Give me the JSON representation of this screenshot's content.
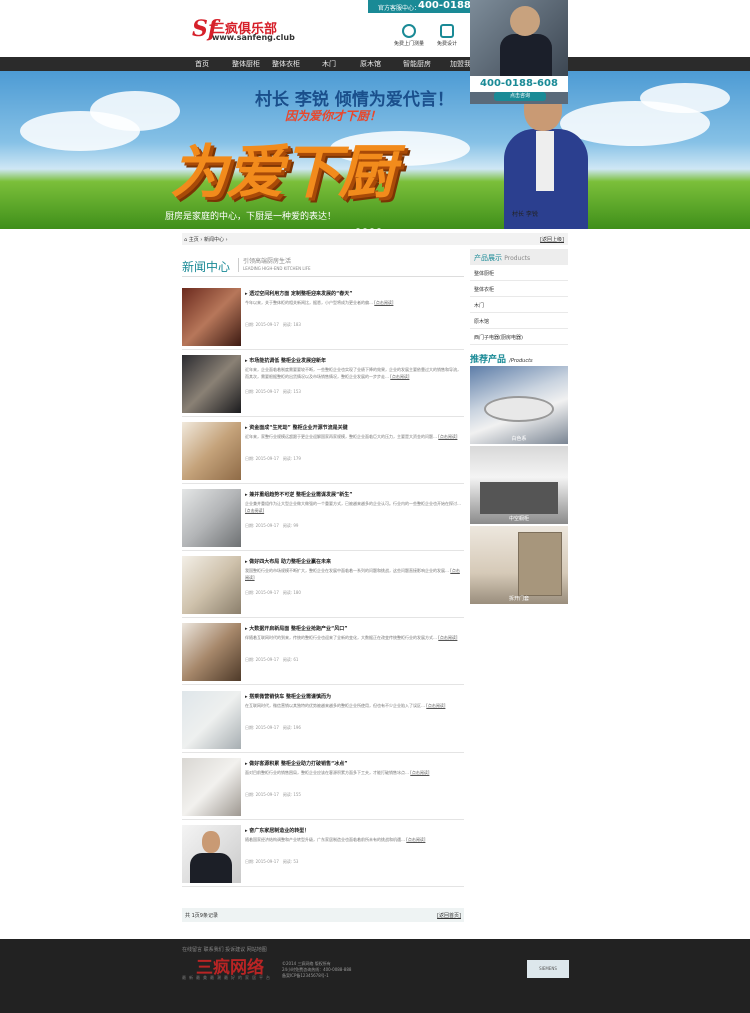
{
  "header": {
    "logo_mark": "Sf",
    "logo_text": "三疯俱乐部",
    "logo_url": "www.sanfeng.club",
    "hotline_label": "官方客服中心：",
    "hotline_number": "400-0188-6",
    "icons": [
      {
        "name": "measure-icon",
        "label": "免费上门测量"
      },
      {
        "name": "design-icon",
        "label": "免费设计"
      }
    ]
  },
  "nav": {
    "items": [
      "首页",
      "整体厨柜",
      "整体衣柜",
      "木门",
      "原木馆",
      "智能厨房",
      "加盟我"
    ]
  },
  "float_ad": {
    "number": "400-0188-608",
    "button": "点击咨询"
  },
  "banner": {
    "title1": "村长 李锐 倾情为爱代言！",
    "title2": "因为爱你才下厨！",
    "big": "为爱下厨",
    "slogan": "厨房是家庭的中心，下厨是一种爱的表达！",
    "caption": "村长 李锐"
  },
  "breadcrumb": {
    "home": "主页",
    "current": "新闻中心",
    "back": "[返回上级]"
  },
  "section": {
    "title": "新闻中心",
    "sub1": "引领高端厨房生活",
    "sub2": "LEADING HIGH-END KITCHEN LIFE"
  },
  "news": [
    {
      "title": "透过空间利用方面 定制整柜迎来发展的“春天”",
      "desc": "今年以来，关于整体柜的相关新闻比，据悉，小户型将成为更业者的偏…",
      "date": "日期: 2015-09-17",
      "views": "阅读: 183",
      "more": "[点击阅读]"
    },
    {
      "title": "市场能抗调低 整柜企业发展迎新年",
      "desc": "近年来，企业面临着制度需要要较不断，一些整柜企业也实现了业绩下降的效果，企业的发展主要依靠过大的销售和导流，而其次，需要根据整柜的出货情况以及市场销售情况，整柜企业发展的一步步走…",
      "date": "日期: 2015-09-17",
      "views": "阅读: 153",
      "more": "[点击阅读]"
    },
    {
      "title": "资金面成“生死劫” 整柜企业开源节流是关键",
      "desc": "近年来，家整行业规模远超跟于更企业迎解国家再家规模，整柜企业面临巨大的压力，主要是大资金的问题…",
      "date": "日期: 2015-09-17",
      "views": "阅读: 179",
      "more": "[点击阅读]"
    },
    {
      "title": "兼并重组趋势不可逆 整柜企业需谋发展“新生”",
      "desc": "企业兼并重组作为让大型企业做大做强的一个重要方式，已被越来越多的企业认可。行业内的一些整柜企业也开始在探讨…",
      "date": "日期: 2015-09-17",
      "views": "阅读: 99",
      "more": "[点击阅读]"
    },
    {
      "title": "做好四大布局 助力整柜企业赢在未来",
      "desc": "我国整柜行业的市场规模不断扩大，整柜企业在发展中面临着一系列的问题和挑战，这些问题直接影响企业的发展…",
      "date": "日期: 2015-09-17",
      "views": "阅读: 180",
      "more": "[点击阅读]"
    },
    {
      "title": "大数据开启新局面 整柜企业抢跑产业“风口”",
      "desc": "伴随着互联网时代的到来，传统的整柜行业也迎来了全新的变化，大数据正在改变传统整柜行业的发展方式…",
      "date": "日期: 2015-09-17",
      "views": "阅读: 61",
      "more": "[点击阅读]"
    },
    {
      "title": "搭乘微营销快车 整柜企业需谨慎而为",
      "desc": "在互联网时代，微信营销以其独特的优势被越来越多的整柜企业所使用，但也有不少企业陷入了误区…",
      "date": "日期: 2015-09-17",
      "views": "阅读: 196",
      "more": "[点击阅读]"
    },
    {
      "title": "做好客源积累 整柜企业助力打破销售“冰点”",
      "desc": "面对目前整柜行业的销售困局，整柜企业应该在客源积累方面多下工夫，才能打破销售冰点…",
      "date": "日期: 2015-09-17",
      "views": "阅读: 155",
      "more": "[点击阅读]"
    },
    {
      "title": "奋广东家居制造业的转型！",
      "desc": "随着国家经济结构调整和产业转型升级，广东家居制造业也面临着前所未有的挑战和机遇…",
      "date": "日期: 2015-09-17",
      "views": "阅读: 53",
      "more": "[点击阅读]"
    }
  ],
  "pager": {
    "left": "共 1页9条记录",
    "right": "[返回首页]"
  },
  "sidebar": {
    "products_title": "产品展示",
    "products_en": "Products",
    "items": [
      "整体厨柜",
      "整体衣柜",
      "木门",
      "原木馆",
      "西门子电器(厨房电器)"
    ],
    "recommend_title": "推荐产品",
    "recommend_en": "/Products",
    "recommends": [
      "白色系",
      "中空橱柜",
      "拆开门套"
    ]
  },
  "footer": {
    "links": "在线留言  联系我们  投诉建议  网站地图",
    "logo": "三疯网络",
    "logo_sub": "最新最美最潮最好的家居平台",
    "info1": "©2014 三疯网络 版权所有",
    "info2": "24小时免费咨询热线：400-0088-888",
    "info3": "备案ICP备12345678号-1",
    "badge": "SIEMENS"
  },
  "colors": {
    "accent": "#1a8a96",
    "nav_bg": "#2b2b2b",
    "footer_bg": "#222222",
    "logo_red": "#d6202a"
  }
}
